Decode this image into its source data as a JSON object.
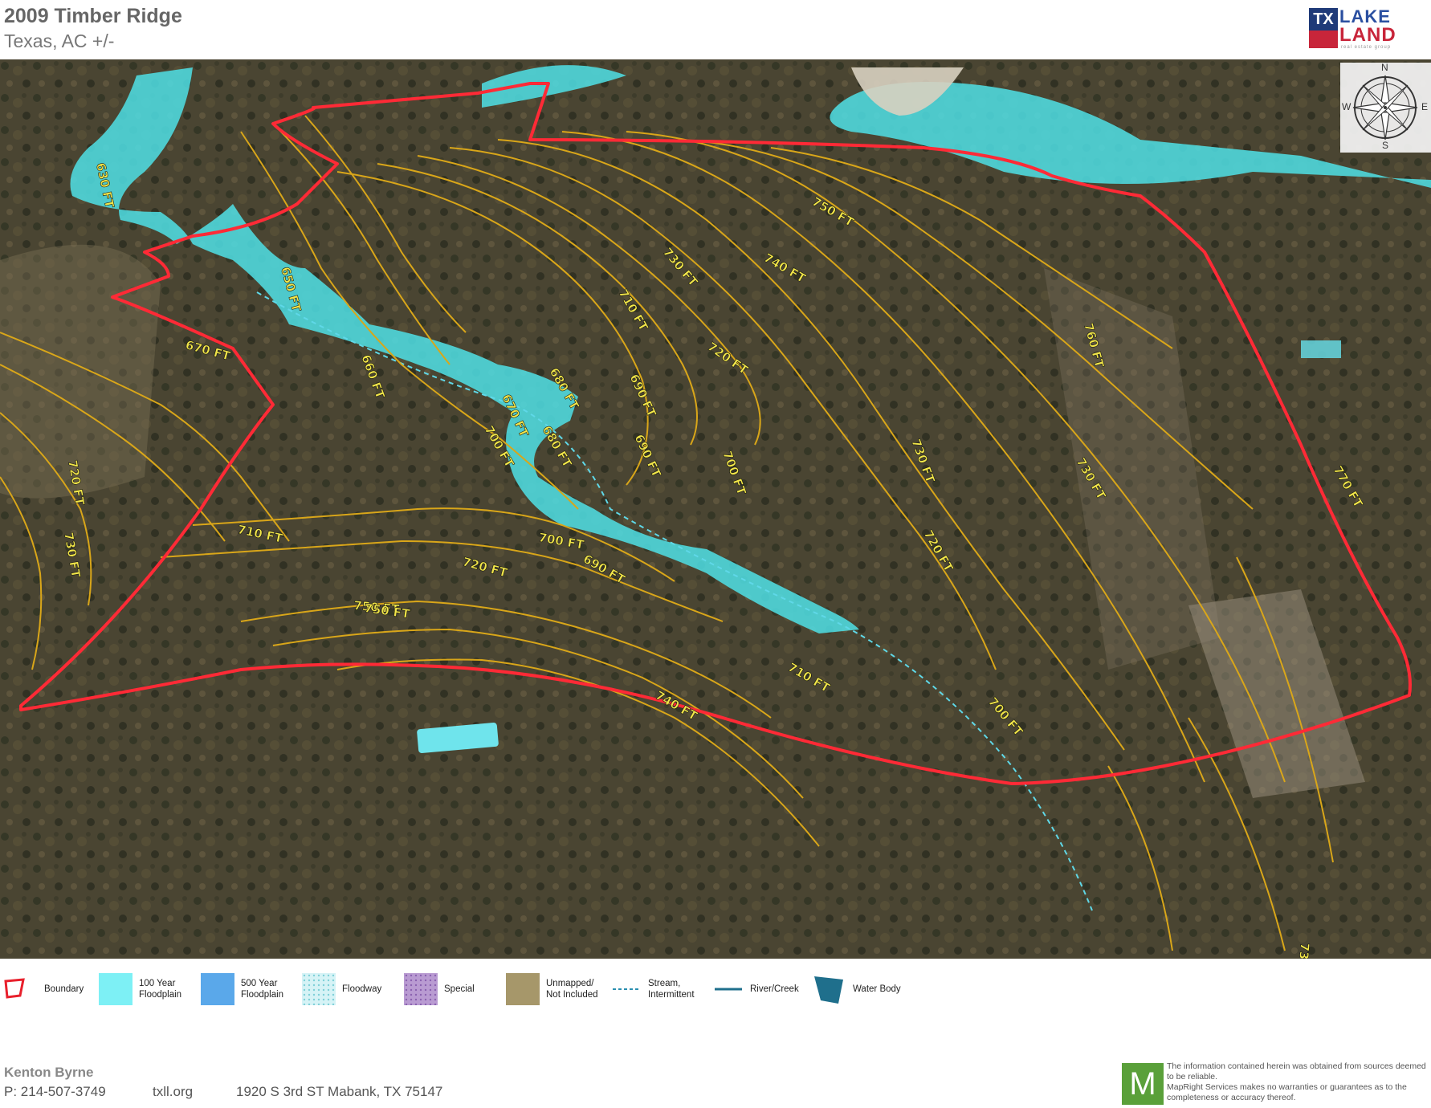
{
  "header": {
    "title": "2009 Timber Ridge",
    "subtitle": "Texas,  AC +/-"
  },
  "logo": {
    "tx": "TX",
    "lake": "LAKE",
    "land": "LAND",
    "tagline": "real estate group"
  },
  "compass": {
    "n": "N",
    "s": "S",
    "e": "E",
    "w": "W"
  },
  "map": {
    "contour_labels": [
      {
        "text": "630 FT"
      },
      {
        "text": "650 FT"
      },
      {
        "text": "660 FT"
      },
      {
        "text": "670 FT"
      },
      {
        "text": "680 FT"
      },
      {
        "text": "690 FT"
      },
      {
        "text": "700 FT"
      },
      {
        "text": "710 FT"
      },
      {
        "text": "720 FT"
      },
      {
        "text": "730 FT"
      },
      {
        "text": "740 FT"
      },
      {
        "text": "750 FT"
      },
      {
        "text": "760 FT"
      },
      {
        "text": "770 FT"
      },
      {
        "text": "730 FT"
      },
      {
        "text": "720 FT"
      },
      {
        "text": "700 FT"
      },
      {
        "text": "690 FT"
      },
      {
        "text": "710 FT"
      },
      {
        "text": "730 FT"
      },
      {
        "text": "720 FT"
      },
      {
        "text": "750 FT"
      },
      {
        "text": "740 FT"
      },
      {
        "text": "710 FT"
      },
      {
        "text": "700 FT"
      },
      {
        "text": "730 FT"
      },
      {
        "text": "670 FT"
      },
      {
        "text": "680 FT"
      },
      {
        "text": "690 FT"
      },
      {
        "text": "700 FT"
      },
      {
        "text": "720 FT"
      },
      {
        "text": "750 FT"
      },
      {
        "text": "730 FT"
      }
    ],
    "colors": {
      "boundary": "#e8202c",
      "floodplain_100": "#4fe0e6",
      "contour": "#d9a619",
      "label": "#f2e64a"
    }
  },
  "legend": [
    {
      "label": "Boundary",
      "swatch": "boundary"
    },
    {
      "label": "100 Year\nFloodplain",
      "swatch": "fp100"
    },
    {
      "label": "500 Year\nFloodplain",
      "swatch": "fp500"
    },
    {
      "label": "Floodway",
      "swatch": "floodway"
    },
    {
      "label": "Special",
      "swatch": "special"
    },
    {
      "label": "Unmapped/\nNot Included",
      "swatch": "unmapped"
    },
    {
      "label": "Stream,\nIntermittent",
      "swatch": "stream"
    },
    {
      "label": "River/Creek",
      "swatch": "river"
    },
    {
      "label": "Water Body",
      "swatch": "water"
    }
  ],
  "footer": {
    "agent_name": "Kenton Byrne",
    "phone": "P: 214-507-3749",
    "website": "txll.org",
    "address": "1920 S 3rd ST Mabank, TX 75147",
    "mr_logo": "M",
    "disclaimer": "The information contained herein was obtained from sources deemed to be reliable.\nMapRight Services makes no warranties or guarantees as to the completeness or accuracy thereof."
  }
}
